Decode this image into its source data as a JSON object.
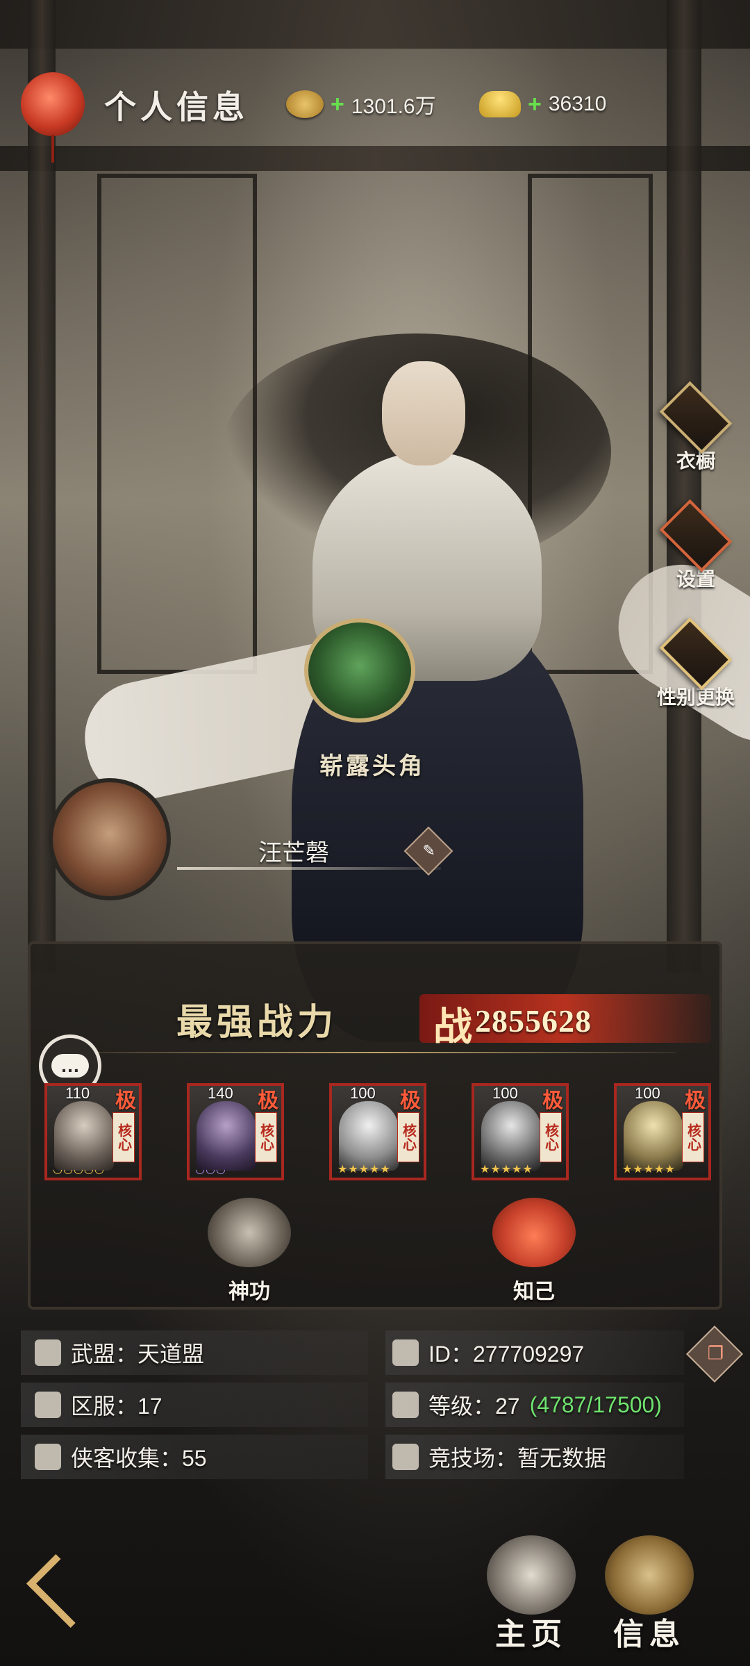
{
  "header": {
    "title": "个人信息"
  },
  "currency": [
    {
      "icon": "coins-icon",
      "value": "1301.6万"
    },
    {
      "icon": "gold-ingot-icon",
      "value": "36310"
    }
  ],
  "side_buttons": [
    {
      "label": "衣橱",
      "icon": "wardrobe-icon"
    },
    {
      "label": "设置",
      "icon": "settings-gear-icon"
    },
    {
      "label": "性别更换",
      "icon": "gender-swap-icon"
    }
  ],
  "emblem": {
    "label": "崭露头角"
  },
  "player": {
    "name": "汪芒磬"
  },
  "power": {
    "title": "最强战力",
    "badge": "战",
    "value": "2855628"
  },
  "heroes": [
    {
      "level": "110",
      "rank": "极",
      "core": "核心",
      "stars": "◡◡◡◡◡"
    },
    {
      "level": "140",
      "rank": "极",
      "core": "核心",
      "stars": "◡◡◡"
    },
    {
      "level": "100",
      "rank": "极",
      "core": "核心",
      "stars": "★★★★★"
    },
    {
      "level": "100",
      "rank": "极",
      "core": "核心",
      "stars": "★★★★★"
    },
    {
      "level": "100",
      "rank": "极",
      "core": "核心",
      "stars": "★★★★★"
    }
  ],
  "skills": [
    {
      "label": "神功"
    },
    {
      "label": "知己"
    }
  ],
  "info": {
    "alliance": "武盟：天道盟",
    "id": "ID：277709297",
    "server": "区服：17",
    "level": "等级：27",
    "exp": "(4787/17500)",
    "collection": "侠客收集：55",
    "arena": "竞技场：暂无数据"
  },
  "bottom_nav": [
    {
      "label": "主页"
    },
    {
      "label": "信息"
    }
  ],
  "colors": {
    "accent_gold": "#c9ad73",
    "power_red": "#b6321f",
    "exp_green": "#6fe36f",
    "plus_green": "#66e04d"
  }
}
